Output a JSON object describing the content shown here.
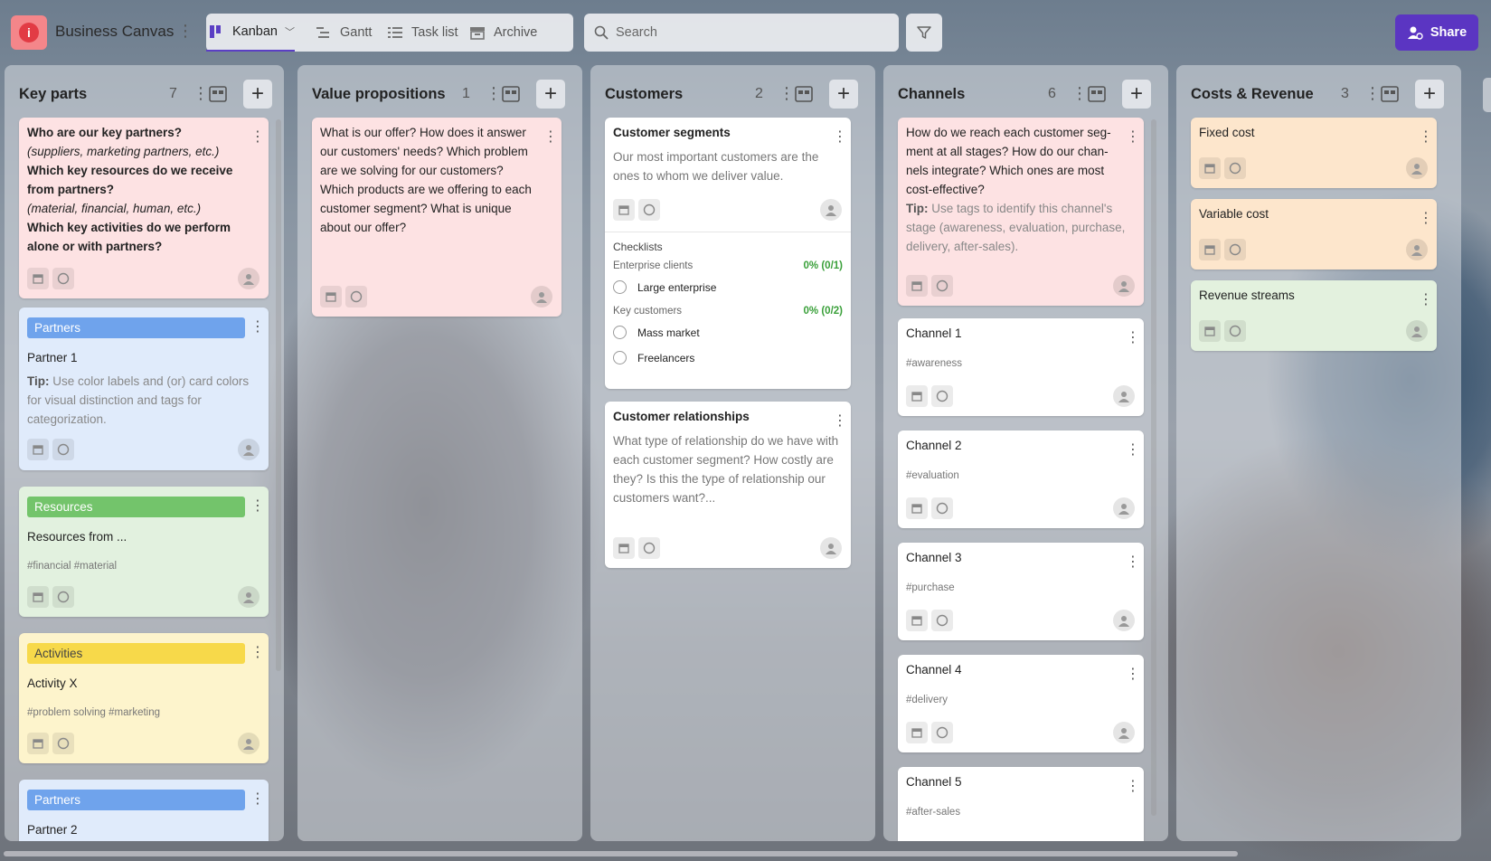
{
  "app": {
    "title": "Business Canvas"
  },
  "views": [
    {
      "label": "Kanban",
      "icon": "kanban-icon",
      "active": true
    },
    {
      "label": "Gantt",
      "icon": "gantt-icon"
    },
    {
      "label": "Task list",
      "icon": "task-list-icon"
    },
    {
      "label": "Archive",
      "icon": "archive-icon"
    }
  ],
  "search": {
    "placeholder": "Search",
    "value": ""
  },
  "share": {
    "label": "Share"
  },
  "colors": {
    "accent": "#5b35c2",
    "label_blue": "#6fa3ec",
    "label_green": "#73c46b",
    "label_yellow": "#f7d94a",
    "checklist_pct": "#3aa03a"
  },
  "columns": [
    {
      "title": "Key parts",
      "count": "7",
      "cards": [
        {
          "l1": "Who are our key partners?",
          "l2": "(suppliers, marketing partners, etc.)",
          "l3": "Which key resources do we receive from partners?",
          "l4": "(material, financial, human, etc.)",
          "l5": "Which key activities do we perform alone or with partners?"
        },
        {
          "label": "Partners",
          "title": "Partner 1",
          "tip_prefix": "Tip:",
          "tip": "Use color labels and (or) card colors for visual distinction and tags for categorization."
        },
        {
          "label": "Resources",
          "title": "Resources from ...",
          "tags": "#financial  #material"
        },
        {
          "label": "Activities",
          "title": "Activity X",
          "tags": "#problem solving  #marketing"
        },
        {
          "label": "Partners",
          "title": "Partner 2"
        }
      ]
    },
    {
      "title": "Value propositions",
      "count": "1",
      "cards": [
        {
          "text": "What is our offer? How does it answer our customers' needs? Which problem are we solving for our customers? Which products are we offering to each customer segment? What is unique about our offer?"
        }
      ]
    },
    {
      "title": "Customers",
      "count": "2",
      "cards": [
        {
          "title": "Customer segments",
          "desc": "Our most important customers are the ones to whom we deliver value.",
          "checklists_title": "Checklists",
          "groups": [
            {
              "name": "Enterprise clients",
              "pct": "0% (0/1)",
              "items": [
                "Large enterprise"
              ]
            },
            {
              "name": "Key customers",
              "pct": "0% (0/2)",
              "items": [
                "Mass market",
                "Freelancers"
              ]
            }
          ]
        },
        {
          "title": "Customer relationships",
          "desc": "What type of relationship do we have with each customer segment? How costly are they? Is this the type of relationship our customers want?..."
        }
      ]
    },
    {
      "title": "Channels",
      "count": "6",
      "cards": [
        {
          "text": "How do we reach each customer seg­ment at all stages? How do our chan­nels integrate? Which ones are most cost-effective?",
          "tip_prefix": "Tip:",
          "tip": "Use tags to identify this channel's stage (awareness, evaluation, purchase, delivery, after-sales)."
        },
        {
          "title": "Channel 1",
          "tag": "#awareness"
        },
        {
          "title": "Channel 2",
          "tag": "#evaluation"
        },
        {
          "title": "Channel 3",
          "tag": "#purchase"
        },
        {
          "title": "Channel 4",
          "tag": "#delivery"
        },
        {
          "title": "Channel 5",
          "tag": "#after-sales"
        }
      ]
    },
    {
      "title": "Costs & Revenue",
      "count": "3",
      "cards": [
        {
          "title": "Fixed cost"
        },
        {
          "title": "Variable cost"
        },
        {
          "title": "Revenue streams"
        }
      ]
    }
  ]
}
